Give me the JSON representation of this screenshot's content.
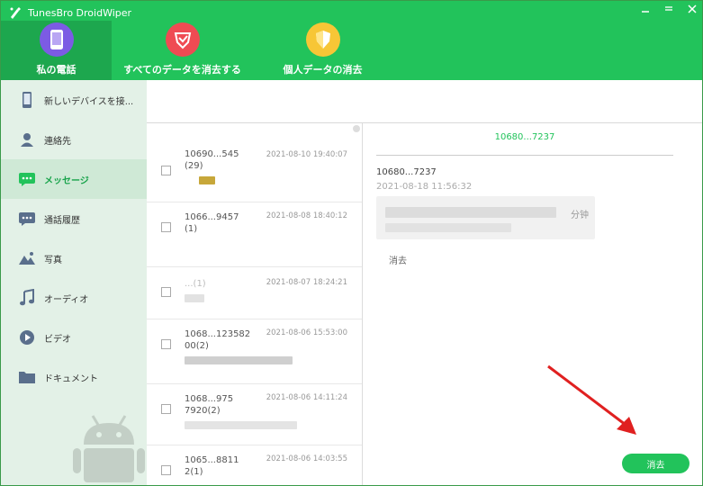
{
  "app": {
    "title": "TunesBro DroidWiper",
    "brand_color": "#22c35b"
  },
  "window_controls": [
    "minimize-icon",
    "maximize-icon",
    "close-icon"
  ],
  "topnav": [
    {
      "label": "私の電話",
      "icon": "phone-icon",
      "active": true
    },
    {
      "label": "すべてのデータを消去する",
      "icon": "eraser-shield-icon",
      "active": false
    },
    {
      "label": "個人データの消去",
      "icon": "shield-icon",
      "active": false
    }
  ],
  "sidebar": {
    "items": [
      {
        "label": "新しいデバイスを接...",
        "icon": "phone-icon"
      },
      {
        "label": "連絡先",
        "icon": "contact-icon"
      },
      {
        "label": "メッセージ",
        "icon": "message-icon",
        "active": true
      },
      {
        "label": "通話履歴",
        "icon": "call-log-icon"
      },
      {
        "label": "写真",
        "icon": "photo-icon"
      },
      {
        "label": "オーディオ",
        "icon": "music-icon"
      },
      {
        "label": "ビデオ",
        "icon": "video-icon"
      },
      {
        "label": "ドキュメント",
        "icon": "folder-icon"
      }
    ]
  },
  "messages": [
    {
      "line1": "10690...545",
      "line2": "(29)",
      "time": "2021-08-10 19:40:07"
    },
    {
      "line1": "1066...9457",
      "line2": "(1)",
      "time": "2021-08-08 18:40:12"
    },
    {
      "line1": "...(1)",
      "line2": "",
      "time": "2021-08-07 18:24:21"
    },
    {
      "line1": "1068...123582",
      "line2": "00(2)",
      "time": "2021-08-06 15:53:00"
    },
    {
      "line1": "1068...975",
      "line2": "7920(2)",
      "time": "2021-08-06 14:11:24"
    },
    {
      "line1": "1065...8811",
      "line2": "2(1)",
      "time": "2021-08-06 14:03:55"
    }
  ],
  "detail": {
    "header": "10680...7237",
    "sender": "10680...7237",
    "time": "2021-08-18 11:56:32",
    "bubble_tail": "分钟",
    "delete_link": "消去",
    "delete_button": "消去"
  },
  "annotation": {
    "arrow_color": "#e02020"
  }
}
